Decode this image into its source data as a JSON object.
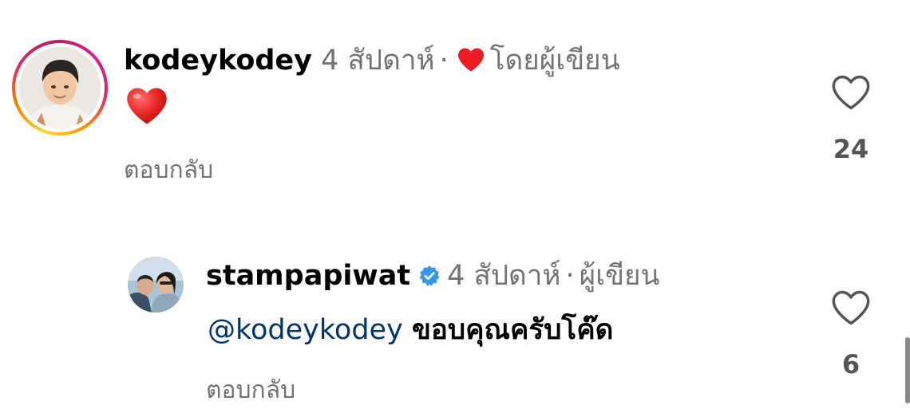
{
  "comments": [
    {
      "username": "kodeykodey",
      "time": "4 สัปดาห์",
      "separator": "·",
      "liked_by_author_label": "โดยผู้เขียน",
      "body": "❤️",
      "reply_label": "ตอบกลับ",
      "likes": "24",
      "avatar_icon": "profile-photo",
      "story_ring": true
    },
    {
      "username": "stampapiwat",
      "verified": true,
      "time": "4 สัปดาห์",
      "separator": "·",
      "author_label": "ผู้เขียน",
      "mention": "@kodeykodey",
      "body": "ขอบคุณครับโค๊ด",
      "reply_label": "ตอบกลับ",
      "likes": "6",
      "avatar_icon": "profile-photo"
    }
  ],
  "colors": {
    "username": "#000000",
    "meta": "#737373",
    "mention": "#00376b",
    "heart": "#ed1c24",
    "verified": "#3797f0"
  }
}
